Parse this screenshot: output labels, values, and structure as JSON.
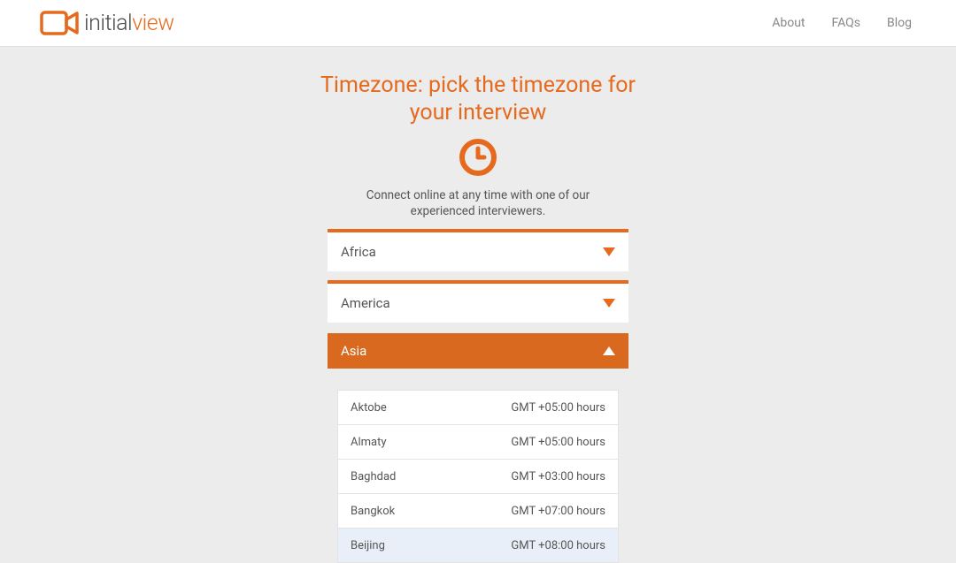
{
  "brand": {
    "first": "initial",
    "second": "view"
  },
  "nav": {
    "items": [
      "About",
      "FAQs",
      "Blog"
    ]
  },
  "page": {
    "title": "Timezone: pick the timezone for your interview",
    "subtitle": "Connect online at any time with one of our experienced interviewers."
  },
  "regions": [
    {
      "label": "Africa",
      "expanded": false
    },
    {
      "label": "America",
      "expanded": false
    },
    {
      "label": "Asia",
      "expanded": true
    }
  ],
  "timezones": [
    {
      "city": "Aktobe",
      "offset": "GMT +05:00 hours",
      "highlight": false
    },
    {
      "city": "Almaty",
      "offset": "GMT +05:00 hours",
      "highlight": false
    },
    {
      "city": "Baghdad",
      "offset": "GMT +03:00 hours",
      "highlight": false
    },
    {
      "city": "Bangkok",
      "offset": "GMT +07:00 hours",
      "highlight": false
    },
    {
      "city": "Beijing",
      "offset": "GMT +08:00 hours",
      "highlight": true
    }
  ],
  "colors": {
    "accent": "#e56a1e"
  }
}
